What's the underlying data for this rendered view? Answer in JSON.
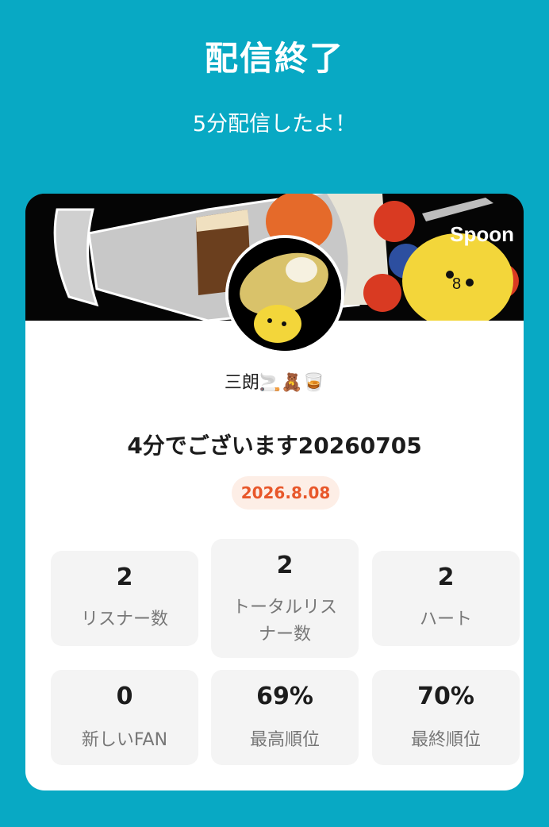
{
  "header": {
    "title": "配信終了",
    "subtitle": "5分配信したよ！"
  },
  "card": {
    "brand": "Spoon",
    "username": "三朗🚬🧸🥃",
    "stream_title": "4分でございます20260705",
    "date": "2026.8.08",
    "stats": [
      {
        "value": "2",
        "label": "リスナー数"
      },
      {
        "value": "2",
        "label": "トータルリスナー数"
      },
      {
        "value": "2",
        "label": "ハート"
      },
      {
        "value": "0",
        "label": "新しいFAN"
      },
      {
        "value": "69%",
        "label": "最高順位"
      },
      {
        "value": "70%",
        "label": "最終順位"
      }
    ]
  },
  "colors": {
    "background": "#08a9c4",
    "card": "#ffffff",
    "badge_text": "#e8572a",
    "badge_bg": "#fdeee6",
    "stat_bg": "#f4f4f4"
  },
  "icons": {
    "banner": "parfait-illustration",
    "avatar": "chick-with-hat-avatar"
  }
}
